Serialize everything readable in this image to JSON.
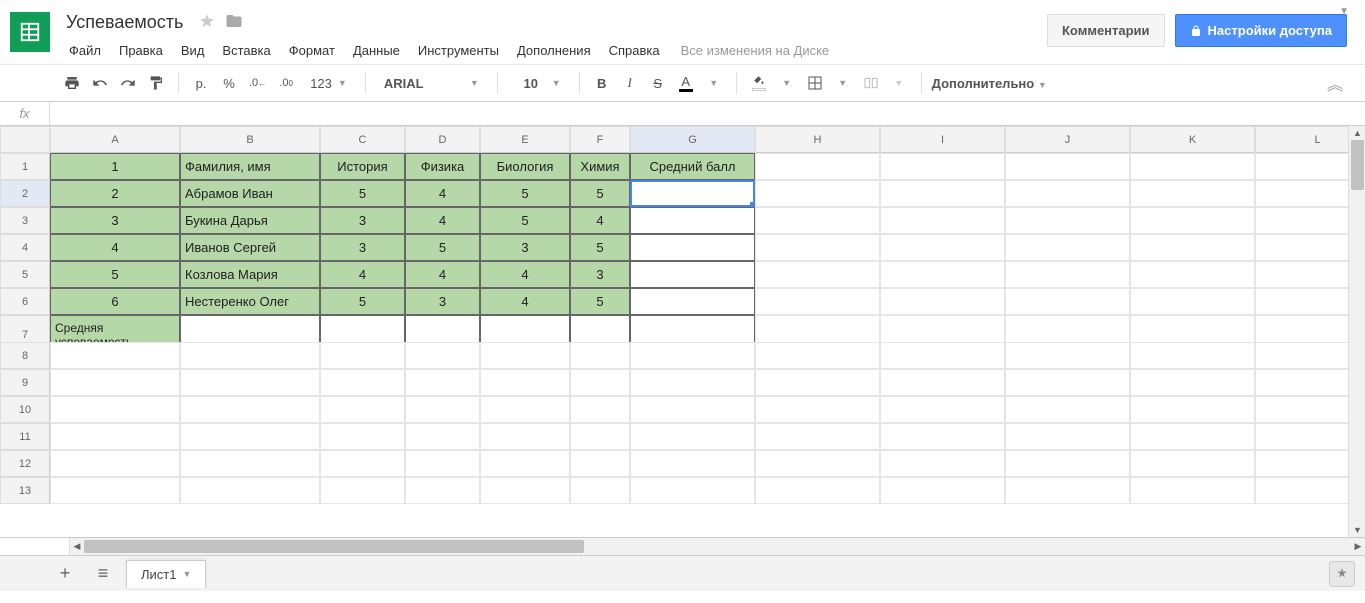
{
  "doc": {
    "title": "Успеваемость"
  },
  "menu": {
    "file": "Файл",
    "edit": "Правка",
    "view": "Вид",
    "insert": "Вставка",
    "format": "Формат",
    "data": "Данные",
    "tools": "Инструменты",
    "addons": "Дополнения",
    "help": "Справка",
    "save_status": "Все изменения на Диске"
  },
  "buttons": {
    "comments": "Комментарии",
    "share": "Настройки доступа"
  },
  "toolbar": {
    "currency": "р.",
    "percent": "%",
    "dec_less": ".0",
    "dec_more": ".00",
    "numfmt": "123",
    "font": "ARIAL",
    "fontsize": "10",
    "more": "Дополнительно"
  },
  "columns": [
    "A",
    "B",
    "C",
    "D",
    "E",
    "F",
    "G",
    "H",
    "I",
    "J",
    "K",
    "L"
  ],
  "rows": [
    "1",
    "2",
    "3",
    "4",
    "5",
    "6",
    "7",
    "8",
    "9",
    "10",
    "11",
    "12",
    "13"
  ],
  "table": {
    "header": {
      "A": "1",
      "B": "Фамилия, имя",
      "C": "История",
      "D": "Физика",
      "E": "Биология",
      "F": "Химия",
      "G": "Средний балл"
    },
    "data": [
      {
        "A": "2",
        "B": "Абрамов Иван",
        "C": "5",
        "D": "4",
        "E": "5",
        "F": "5"
      },
      {
        "A": "3",
        "B": "Букина Дарья",
        "C": "3",
        "D": "4",
        "E": "5",
        "F": "4"
      },
      {
        "A": "4",
        "B": "Иванов Сергей",
        "C": "3",
        "D": "5",
        "E": "3",
        "F": "5"
      },
      {
        "A": "5",
        "B": "Козлова Мария",
        "C": "4",
        "D": "4",
        "E": "4",
        "F": "3"
      },
      {
        "A": "6",
        "B": "Нестеренко Олег",
        "C": "5",
        "D": "3",
        "E": "4",
        "F": "5"
      }
    ],
    "footer": {
      "A": "Средняя успеваемость"
    }
  },
  "sheet": {
    "tab": "Лист1"
  },
  "icons": {
    "print": "print-icon",
    "undo": "undo-icon",
    "redo": "redo-icon",
    "paint": "paint-format-icon",
    "bold": "B",
    "italic": "I",
    "strike": "S",
    "textcolor": "A",
    "fill": "fill-icon",
    "borders": "borders-icon",
    "merge": "merge-icon",
    "star": "star-icon",
    "folder": "folder-icon",
    "lock": "lock-icon",
    "add": "+",
    "allsheets": "≡",
    "explore": "✦",
    "chevup": "︽"
  },
  "active": {
    "col": "G",
    "row": "2",
    "cell": "G2"
  }
}
